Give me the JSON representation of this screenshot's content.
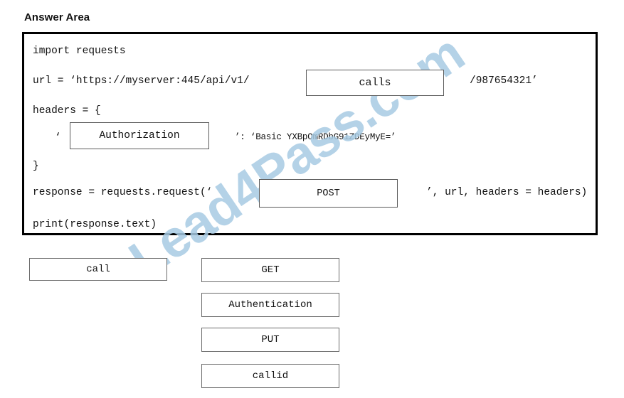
{
  "page": {
    "title": "Answer Area"
  },
  "code": {
    "lines": {
      "import": "import requests",
      "url_head": "url = ‘https://myserver:445/api/v1/",
      "url_tail": "/987654321’",
      "headers_open": "headers = {",
      "header_quote": "‘",
      "header_tail": "’: ‘Basic YXBpOmRDbG91ZDEyMyE=’",
      "brace_close": "}",
      "response_head": "response = requests.request(‘",
      "response_tail": "’, url, headers = headers)",
      "print": "print(response.text)"
    },
    "drop_zones": [
      {
        "id": "url-segment",
        "value": "calls"
      },
      {
        "id": "header-key",
        "value": "Authorization"
      },
      {
        "id": "http-method",
        "value": "POST"
      }
    ]
  },
  "options": [
    {
      "id": "call",
      "label": "call"
    },
    {
      "id": "get",
      "label": "GET"
    },
    {
      "id": "authentication",
      "label": "Authentication"
    },
    {
      "id": "put",
      "label": "PUT"
    },
    {
      "id": "callid",
      "label": "callid"
    }
  ],
  "watermark": {
    "text": "Lead4Pass.com",
    "color": "#a7cbe3"
  }
}
